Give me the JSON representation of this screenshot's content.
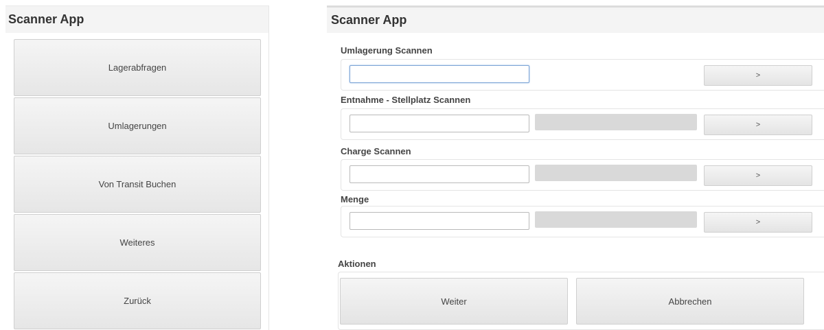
{
  "left": {
    "title": "Scanner App",
    "menu": [
      {
        "label": "Lagerabfragen"
      },
      {
        "label": "Umlagerungen"
      },
      {
        "label": "Von Transit Buchen"
      },
      {
        "label": "Weiteres"
      },
      {
        "label": "Zurück"
      }
    ]
  },
  "right": {
    "title": "Scanner App",
    "sections": [
      {
        "label": "Umlagerung Scannen",
        "input_value": "",
        "has_display": false,
        "button_label": ">"
      },
      {
        "label": "Entnahme - Stellplatz Scannen",
        "input_value": "",
        "has_display": true,
        "button_label": ">"
      },
      {
        "label": "Charge Scannen",
        "input_value": "",
        "has_display": true,
        "button_label": ">"
      },
      {
        "label": "Menge",
        "input_value": "",
        "has_display": true,
        "button_label": ">"
      }
    ],
    "actions_label": "Aktionen",
    "actions": {
      "next_label": "Weiter",
      "cancel_label": "Abbrechen"
    }
  }
}
